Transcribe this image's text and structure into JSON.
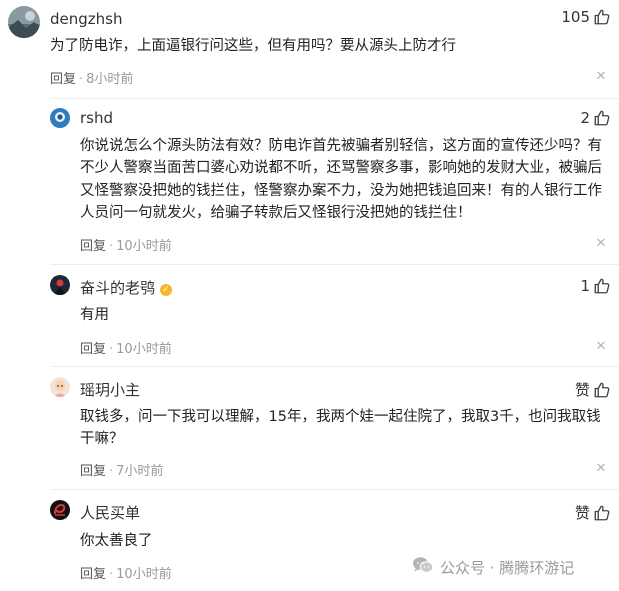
{
  "comments": [
    {
      "username": "dengzhsh",
      "likes": "105",
      "text": "为了防电诈，上面逼银行问这些，但有用吗？要从源头上防才行",
      "reply_label": "回复",
      "time": "8小时前"
    },
    {
      "username": "rshd",
      "likes": "2",
      "text": "你说说怎么个源头防法有效？防电诈首先被骗者别轻信，这方面的宣传还少吗？有不少人警察当面苦口婆心劝说都不听，还骂警察多事，影响她的发财大业，被骗后又怪警察没把她的钱拦住，怪警察办案不力，没为她把钱追回来！有的人银行工作人员问一句就发火，给骗子转款后又怪银行没把她的钱拦住！",
      "reply_label": "回复",
      "time": "10小时前"
    },
    {
      "username": "奋斗的老鸮",
      "likes": "1",
      "text": "有用",
      "reply_label": "回复",
      "time": "10小时前"
    },
    {
      "username": "瑶玥小主",
      "likes": "赞",
      "text": "取钱多，问一下我可以理解，15年，我两个娃一起住院了，我取3千，也问我取钱干嘛？",
      "reply_label": "回复",
      "time": "7小时前"
    },
    {
      "username": "人民买单",
      "likes": "赞",
      "text": "你太善良了",
      "reply_label": "回复",
      "time": "10小时前"
    }
  ],
  "watermark": {
    "text": "公众号 · 腾腾环游记"
  },
  "colors": {
    "badge": "#f5b82b",
    "text_secondary": "#999999"
  }
}
